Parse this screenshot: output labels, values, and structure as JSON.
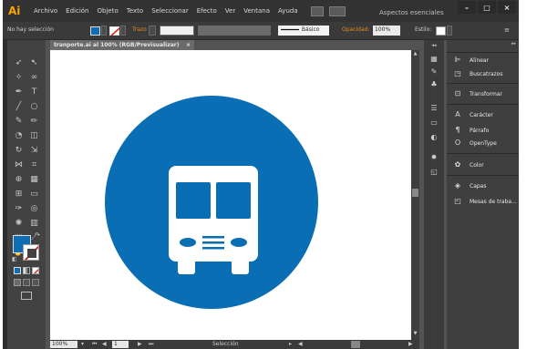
{
  "app": {
    "logo": "Ai",
    "workspace": "Aspectos esenciales"
  },
  "menu": [
    "Archivo",
    "Edición",
    "Objeto",
    "Texto",
    "Seleccionar",
    "Efecto",
    "Ver",
    "Ventana",
    "Ayuda"
  ],
  "window_controls": [
    "–",
    "□",
    "×"
  ],
  "control_bar": {
    "selection": "No hay selección",
    "stroke_label": "Trazo",
    "brush": "Básico",
    "opacity_label": "Opacidad:",
    "opacity_value": "100%",
    "style_label": "Estilo:"
  },
  "document": {
    "tab_title": "tranporte.ai al 100% (RGB/Previsualizar)",
    "tab_close": "×"
  },
  "status": {
    "zoom": "100%",
    "page": "1",
    "tool": "Selección"
  },
  "panels": [
    "Alinear",
    "Buscatrazos",
    "Transformar",
    "Carácter",
    "Párrafo",
    "OpenType",
    "Color",
    "Capas",
    "Mesas de traba..."
  ],
  "colors": {
    "accent_blue": "#0F6DB3",
    "circle_blue": "#0A6EB5"
  },
  "icons": {
    "tools": [
      "selection-icon",
      "direct-selection-icon",
      "magic-wand-icon",
      "lasso-icon",
      "pen-icon",
      "type-icon",
      "line-icon",
      "ellipse-icon",
      "paintbrush-icon",
      "pencil-icon",
      "blob-brush-icon",
      "eraser-icon",
      "rotate-icon",
      "scale-icon",
      "width-icon",
      "free-transform-icon",
      "shape-builder-icon",
      "perspective-icon",
      "mesh-icon",
      "gradient-icon",
      "eyedropper-icon",
      "blend-icon",
      "symbol-sprayer-icon",
      "graph-icon",
      "artboard-icon",
      "slice-icon",
      "hand-icon",
      "zoom-icon"
    ]
  }
}
